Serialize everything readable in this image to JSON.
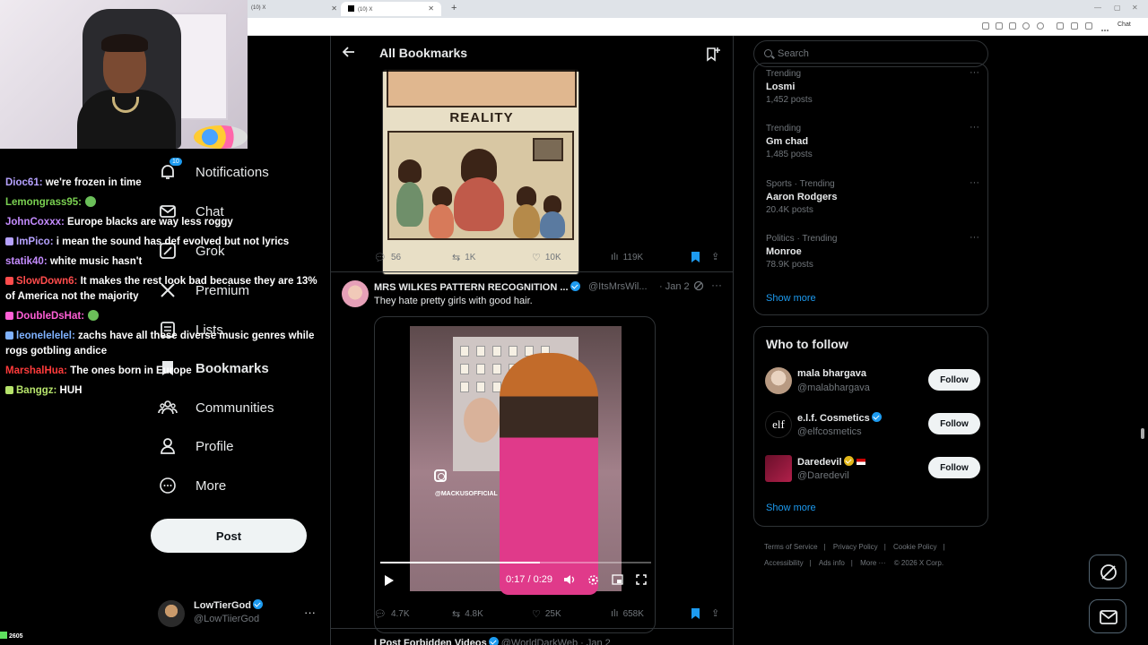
{
  "browser": {
    "tabs": [
      {
        "label": "(10) X"
      },
      {
        "label": "(10) X"
      }
    ],
    "new_tab": "+",
    "chat_button": "Chat"
  },
  "stream": {
    "viewer_count": "2605",
    "chat": [
      {
        "user": "Dioc61:",
        "msg": " we're frozen in time",
        "color": "#b6a2ff"
      },
      {
        "user": "Lemongrass95:",
        "msg": "",
        "color": "#7ad151"
      },
      {
        "user": "JohnCoxxx:",
        "msg": " Europe blacks are way less roggy",
        "color": "#c58cff"
      },
      {
        "user": "ImPico:",
        "msg": " i mean the sound has def evolved but not lyrics",
        "color": "#b6a2ff"
      },
      {
        "user": "statik40:",
        "msg": " white music hasn't",
        "color": "#c58cff"
      },
      {
        "user": "SlowDown6:",
        "msg": " It makes the rest look bad because they are 13% of America not the majority",
        "color": "#ff4c4c"
      },
      {
        "user": "DoubleDsHat:",
        "msg": "",
        "color": "#ff5fd6"
      },
      {
        "user": "leonelelelel:",
        "msg": " zachs have all these diverse music genres while rogs gotbling andice",
        "color": "#7fb2ff"
      },
      {
        "user": "MarshalHua:",
        "msg": " The ones born in Europe",
        "color": "#ff3b3b"
      },
      {
        "user": "Banggz:",
        "msg": " HUH",
        "color": "#b6e36b"
      }
    ]
  },
  "nav": {
    "notifications": {
      "label": "Notifications",
      "count": "10"
    },
    "chat": "Chat",
    "grok": "Grok",
    "premium": "Premium",
    "lists": "Lists",
    "bookmarks": "Bookmarks",
    "communities": "Communities",
    "profile": "Profile",
    "more": "More",
    "post": "Post",
    "account": {
      "name": "LowTierGod",
      "handle": "@LowTiierGod",
      "more": "···"
    }
  },
  "main": {
    "title": "All Bookmarks",
    "post1": {
      "image_text": "REALITY",
      "replies": "56",
      "reposts": "1K",
      "likes": "10K",
      "views": "119K"
    },
    "post2": {
      "name": "MRS WILKES PATTERN RECOGNITION ...",
      "handle": "@ItsMrsWil...",
      "date": "· Jan 2",
      "text": "They hate pretty girls with good hair.",
      "video": {
        "watermark": "@MACKUSOFFICIAL",
        "time": "0:17 / 0:29",
        "progress": 0.59
      },
      "replies": "4.7K",
      "reposts": "4.8K",
      "likes": "25K",
      "views": "658K"
    },
    "post3": {
      "name": "I Post Forbidden Videos",
      "handle": "@WorldDarkWeb",
      "date": "· Jan 2"
    }
  },
  "right": {
    "search_placeholder": "Search",
    "trends": [
      {
        "meta": "Trending",
        "name": "Losmi",
        "count": "1,452 posts"
      },
      {
        "meta": "Trending",
        "name": "Gm chad",
        "count": "1,485 posts"
      },
      {
        "meta": "Sports · Trending",
        "name": "Aaron Rodgers",
        "count": "20.4K posts"
      },
      {
        "meta": "Politics · Trending",
        "name": "Monroe",
        "count": "78.9K posts"
      }
    ],
    "trends_show_more": "Show more",
    "who_to_follow": {
      "title": "Who to follow",
      "accounts": [
        {
          "name": "mala bhargava",
          "handle": "@malabhargava",
          "button": "Follow"
        },
        {
          "name": "e.l.f. Cosmetics",
          "handle": "@elfcosmetics",
          "button": "Follow"
        },
        {
          "name": "Daredevil",
          "handle": "@Daredevil",
          "button": "Follow"
        }
      ],
      "show_more": "Show more"
    },
    "footer": {
      "terms": "Terms of Service",
      "privacy": "Privacy Policy",
      "cookie": "Cookie Policy",
      "accessibility": "Accessibility",
      "ads": "Ads info",
      "more": "More ···",
      "copyright": "© 2026 X Corp."
    }
  }
}
